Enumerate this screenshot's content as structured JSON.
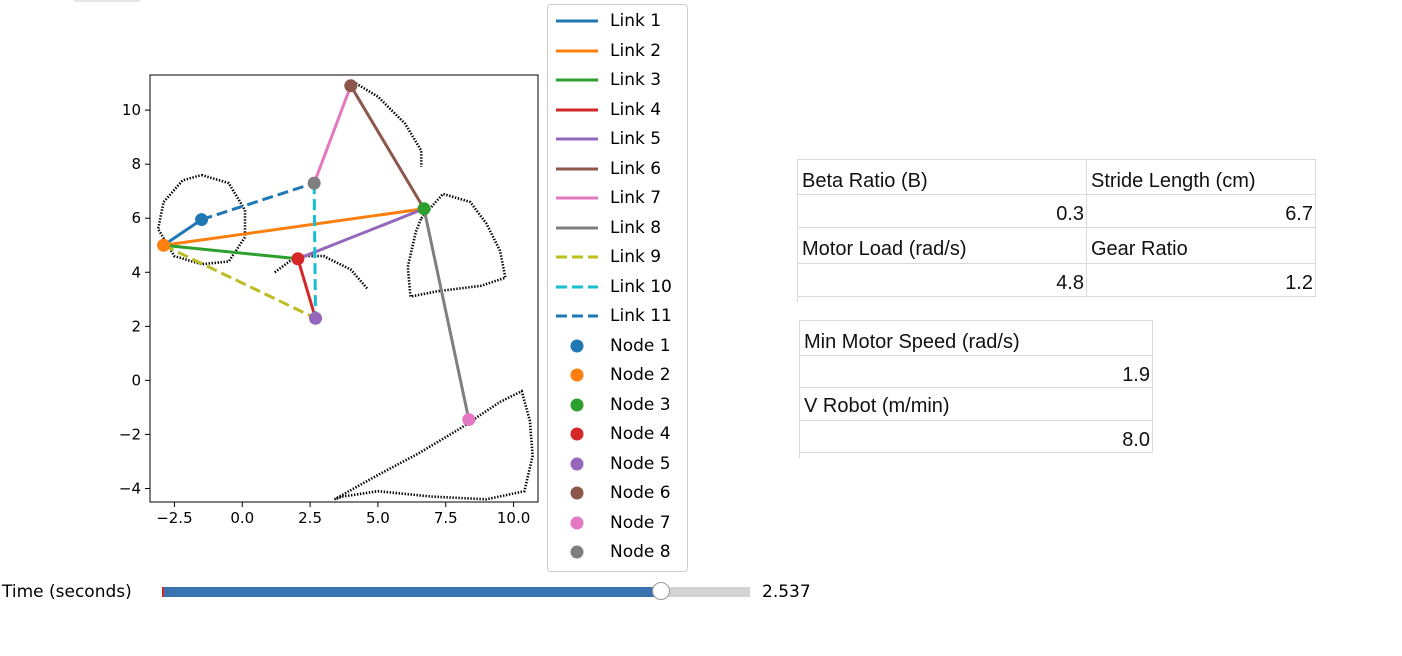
{
  "chart_data": {
    "type": "scatter",
    "title": "",
    "xlabel": "",
    "ylabel": "",
    "xlim": [
      -3.4,
      10.9
    ],
    "ylim": [
      -4.5,
      11.3
    ],
    "xticks": [
      "−2.5",
      "0.0",
      "2.5",
      "5.0",
      "7.5",
      "10.0"
    ],
    "xtick_values": [
      -2.5,
      0,
      2.5,
      5,
      7.5,
      10
    ],
    "yticks": [
      "−4",
      "−2",
      "0",
      "2",
      "4",
      "6",
      "8",
      "10"
    ],
    "ytick_values": [
      -4,
      -2,
      0,
      2,
      4,
      6,
      8,
      10
    ],
    "nodes": [
      {
        "name": "Node 1",
        "x": -1.5,
        "y": 5.95,
        "color": "#1f77b4"
      },
      {
        "name": "Node 2",
        "x": -2.9,
        "y": 5.0,
        "color": "#ff7f0e"
      },
      {
        "name": "Node 3",
        "x": 6.7,
        "y": 6.35,
        "color": "#2ca02c"
      },
      {
        "name": "Node 4",
        "x": 2.05,
        "y": 4.5,
        "color": "#d62728"
      },
      {
        "name": "Node 5",
        "x": 2.7,
        "y": 2.3,
        "color": "#9467bd"
      },
      {
        "name": "Node 6",
        "x": 4.0,
        "y": 10.9,
        "color": "#8c564b"
      },
      {
        "name": "Node 7",
        "x": 8.35,
        "y": -1.45,
        "color": "#e377c2"
      },
      {
        "name": "Node 8",
        "x": 2.65,
        "y": 7.3,
        "color": "#7f7f7f"
      }
    ],
    "links": [
      {
        "name": "Link 1",
        "from": "Node 2",
        "to": "Node 1",
        "color": "#1f77b4",
        "style": "solid"
      },
      {
        "name": "Link 2",
        "from": "Node 2",
        "to": "Node 3",
        "color": "#ff7f0e",
        "style": "solid"
      },
      {
        "name": "Link 3",
        "from": "Node 2",
        "to": "Node 4",
        "color": "#2ca02c",
        "style": "solid"
      },
      {
        "name": "Link 4",
        "from": "Node 4",
        "to": "Node 5",
        "color": "#d62728",
        "style": "solid"
      },
      {
        "name": "Link 5",
        "from": "Node 4",
        "to": "Node 3",
        "color": "#9467bd",
        "style": "solid"
      },
      {
        "name": "Link 6",
        "from": "Node 3",
        "to": "Node 6",
        "color": "#8c564b",
        "style": "solid"
      },
      {
        "name": "Link 7",
        "from": "Node 8",
        "to": "Node 6",
        "color": "#e377c2",
        "style": "solid"
      },
      {
        "name": "Link 8",
        "from": "Node 3",
        "to": "Node 7",
        "color": "#7f7f7f",
        "style": "solid"
      },
      {
        "name": "Link 9",
        "from": "Node 2",
        "to": "Node 5",
        "color": "#bcbd22",
        "style": "dashed"
      },
      {
        "name": "Link 10",
        "from": "Node 8",
        "to": "Node 5",
        "color": "#17becf",
        "style": "dashed"
      },
      {
        "name": "Link 11",
        "from": "Node 1",
        "to": "Node 8",
        "color": "#1f77b4",
        "style": "dashed"
      }
    ],
    "traces": [
      {
        "points": [
          [
            -1.5,
            7.6
          ],
          [
            -0.5,
            7.3
          ],
          [
            0.1,
            6.3
          ],
          [
            0.1,
            5.3
          ],
          [
            -0.5,
            4.4
          ],
          [
            -1.5,
            4.3
          ],
          [
            -2.5,
            4.6
          ],
          [
            -3.1,
            5.6
          ],
          [
            -2.9,
            6.6
          ],
          [
            -2.2,
            7.4
          ],
          [
            -1.5,
            7.6
          ]
        ]
      },
      {
        "points": [
          [
            1.2,
            4.0
          ],
          [
            2.0,
            4.6
          ],
          [
            3.0,
            4.6
          ],
          [
            4.0,
            4.1
          ],
          [
            4.6,
            3.4
          ]
        ]
      },
      {
        "points": [
          [
            4.0,
            11.1
          ],
          [
            5.0,
            10.5
          ],
          [
            6.0,
            9.5
          ],
          [
            6.6,
            8.5
          ],
          [
            6.6,
            7.9
          ]
        ]
      },
      {
        "points": [
          [
            6.6,
            6.0
          ],
          [
            7.4,
            6.9
          ],
          [
            8.4,
            6.6
          ],
          [
            9.0,
            5.8
          ],
          [
            9.5,
            4.8
          ],
          [
            9.7,
            3.8
          ],
          [
            8.8,
            3.5
          ],
          [
            7.2,
            3.3
          ],
          [
            6.2,
            3.1
          ],
          [
            6.1,
            4.2
          ],
          [
            6.4,
            5.5
          ],
          [
            6.6,
            6.0
          ]
        ]
      },
      {
        "points": [
          [
            3.4,
            -4.4
          ],
          [
            5.0,
            -3.5
          ],
          [
            6.5,
            -2.7
          ],
          [
            8.0,
            -1.8
          ],
          [
            9.5,
            -0.8
          ],
          [
            10.3,
            -0.4
          ],
          [
            10.6,
            -1.5
          ],
          [
            10.7,
            -2.8
          ],
          [
            10.4,
            -4.1
          ],
          [
            9.0,
            -4.4
          ],
          [
            7.0,
            -4.3
          ],
          [
            5.0,
            -4.1
          ],
          [
            3.7,
            -4.3
          ],
          [
            3.4,
            -4.4
          ]
        ]
      }
    ]
  },
  "legend": {
    "items": [
      {
        "label": "Link 1",
        "kind": "line",
        "color": "#1f77b4",
        "style": "solid"
      },
      {
        "label": "Link 2",
        "kind": "line",
        "color": "#ff7f0e",
        "style": "solid"
      },
      {
        "label": "Link 3",
        "kind": "line",
        "color": "#2ca02c",
        "style": "solid"
      },
      {
        "label": "Link 4",
        "kind": "line",
        "color": "#d62728",
        "style": "solid"
      },
      {
        "label": "Link 5",
        "kind": "line",
        "color": "#9467bd",
        "style": "solid"
      },
      {
        "label": "Link 6",
        "kind": "line",
        "color": "#8c564b",
        "style": "solid"
      },
      {
        "label": "Link 7",
        "kind": "line",
        "color": "#e377c2",
        "style": "solid"
      },
      {
        "label": "Link 8",
        "kind": "line",
        "color": "#7f7f7f",
        "style": "solid"
      },
      {
        "label": "Link 9",
        "kind": "line",
        "color": "#bcbd22",
        "style": "dashed"
      },
      {
        "label": "Link 10",
        "kind": "line",
        "color": "#17becf",
        "style": "dashed"
      },
      {
        "label": "Link 11",
        "kind": "line",
        "color": "#1f77b4",
        "style": "dashed"
      },
      {
        "label": "Node 1",
        "kind": "dot",
        "color": "#1f77b4"
      },
      {
        "label": "Node 2",
        "kind": "dot",
        "color": "#ff7f0e"
      },
      {
        "label": "Node 3",
        "kind": "dot",
        "color": "#2ca02c"
      },
      {
        "label": "Node 4",
        "kind": "dot",
        "color": "#d62728"
      },
      {
        "label": "Node 5",
        "kind": "dot",
        "color": "#9467bd"
      },
      {
        "label": "Node 6",
        "kind": "dot",
        "color": "#8c564b"
      },
      {
        "label": "Node 7",
        "kind": "dot",
        "color": "#e377c2"
      },
      {
        "label": "Node 8",
        "kind": "dot",
        "color": "#7f7f7f"
      }
    ]
  },
  "slider": {
    "label": "Time (seconds)",
    "value_text": "2.537",
    "fraction": 0.85,
    "fill_color": "#3a73b0"
  },
  "sheet1": {
    "beta_label": "Beta Ratio (B)",
    "beta_value": "0.3",
    "stride_label": "Stride Length (cm)",
    "stride_value": "6.7",
    "motor_load_label": "Motor Load (rad/s)",
    "motor_load_value": "4.8",
    "gear_label": "Gear Ratio",
    "gear_value": "1.2"
  },
  "sheet2": {
    "min_speed_label": "Min Motor Speed (rad/s)",
    "min_speed_value": "1.9",
    "v_robot_label": "V Robot (m/min)",
    "v_robot_value": "8.0"
  }
}
